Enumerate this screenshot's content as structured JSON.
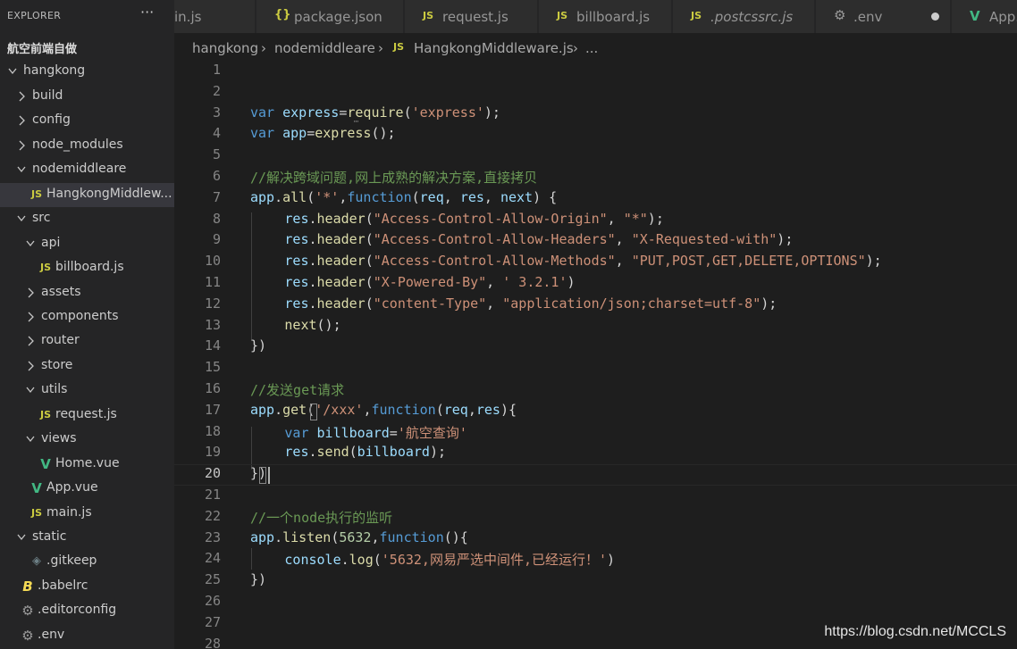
{
  "colors": {
    "keyword": "#569cd6",
    "variable": "#9cdcfe",
    "function": "#dcdcaa",
    "string": "#ce9178",
    "comment": "#6a9955",
    "number": "#b5cea8",
    "punct": "#d4d4d4",
    "js_badge": "#cbcb41",
    "vue_badge": "#42b883",
    "json_badge": "#cbcb41",
    "babel_badge": "#f5da55",
    "gear_icon": "#9a9a9a"
  },
  "sidebar": {
    "title": "EXPLORER",
    "more_icon": "ellipsis-icon",
    "tree": [
      {
        "label": "航空前端自做",
        "depth": 0,
        "kind": "root",
        "chevron": "none"
      },
      {
        "label": "hangkong",
        "depth": 0,
        "kind": "folder",
        "chevron": "open"
      },
      {
        "label": "build",
        "depth": 1,
        "kind": "folder",
        "chevron": "closed"
      },
      {
        "label": "config",
        "depth": 1,
        "kind": "folder",
        "chevron": "closed"
      },
      {
        "label": "node_modules",
        "depth": 1,
        "kind": "folder",
        "chevron": "closed"
      },
      {
        "label": "nodemiddleare",
        "depth": 1,
        "kind": "folder",
        "chevron": "open"
      },
      {
        "label": "HangkongMiddlew...",
        "depth": 2,
        "kind": "js",
        "chevron": "none",
        "selected": true
      },
      {
        "label": "src",
        "depth": 1,
        "kind": "folder",
        "chevron": "open"
      },
      {
        "label": "api",
        "depth": 2,
        "kind": "folder",
        "chevron": "open"
      },
      {
        "label": "billboard.js",
        "depth": 3,
        "kind": "js",
        "chevron": "none"
      },
      {
        "label": "assets",
        "depth": 2,
        "kind": "folder",
        "chevron": "closed"
      },
      {
        "label": "components",
        "depth": 2,
        "kind": "folder",
        "chevron": "closed"
      },
      {
        "label": "router",
        "depth": 2,
        "kind": "folder",
        "chevron": "closed"
      },
      {
        "label": "store",
        "depth": 2,
        "kind": "folder",
        "chevron": "closed"
      },
      {
        "label": "utils",
        "depth": 2,
        "kind": "folder",
        "chevron": "open"
      },
      {
        "label": "request.js",
        "depth": 3,
        "kind": "js",
        "chevron": "none"
      },
      {
        "label": "views",
        "depth": 2,
        "kind": "folder",
        "chevron": "open"
      },
      {
        "label": "Home.vue",
        "depth": 3,
        "kind": "vue",
        "chevron": "none"
      },
      {
        "label": "App.vue",
        "depth": 2,
        "kind": "vue",
        "chevron": "none"
      },
      {
        "label": "main.js",
        "depth": 2,
        "kind": "js",
        "chevron": "none"
      },
      {
        "label": "static",
        "depth": 1,
        "kind": "folder",
        "chevron": "open"
      },
      {
        "label": ".gitkeep",
        "depth": 2,
        "kind": "gitkeep",
        "chevron": "none"
      },
      {
        "label": ".babelrc",
        "depth": 1,
        "kind": "babel",
        "chevron": "none"
      },
      {
        "label": ".editorconfig",
        "depth": 1,
        "kind": "gear",
        "chevron": "none"
      },
      {
        "label": ".env",
        "depth": 1,
        "kind": "gear",
        "chevron": "none"
      }
    ]
  },
  "tabs": [
    {
      "label": "in.js",
      "kind": "none"
    },
    {
      "label": "package.json",
      "kind": "json"
    },
    {
      "label": "request.js",
      "kind": "js"
    },
    {
      "label": "billboard.js",
      "kind": "js"
    },
    {
      "label": ".postcssrc.js",
      "kind": "js",
      "italic": true
    },
    {
      "label": ".env",
      "kind": "gear",
      "dirty": true
    },
    {
      "label": "App.v",
      "kind": "vue"
    }
  ],
  "badges": {
    "js": "JS",
    "json": "{}",
    "vue": "V",
    "babel": "B"
  },
  "breadcrumb": {
    "items": [
      "hangkong",
      "nodemiddleare",
      "HangkongMiddleware.js",
      "..."
    ],
    "file_badge": "JS",
    "separator": "›"
  },
  "editor": {
    "current_line": 20,
    "lines": [
      {
        "n": "1",
        "indent": 0,
        "tokens": []
      },
      {
        "n": "2",
        "indent": 0,
        "tokens": []
      },
      {
        "n": "3",
        "indent": 0,
        "tokens": [
          [
            "keyword",
            "var"
          ],
          [
            "punct",
            " "
          ],
          [
            "variable",
            "express"
          ],
          [
            "punct",
            "="
          ],
          [
            "function",
            "require"
          ],
          [
            "punct",
            "("
          ],
          [
            "string",
            "'express'"
          ],
          [
            "punct",
            ");"
          ]
        ]
      },
      {
        "n": "4",
        "indent": 0,
        "tokens": [
          [
            "keyword",
            "var"
          ],
          [
            "punct",
            " "
          ],
          [
            "variable",
            "app"
          ],
          [
            "punct",
            "="
          ],
          [
            "function",
            "express"
          ],
          [
            "punct",
            "();"
          ]
        ]
      },
      {
        "n": "5",
        "indent": 0,
        "tokens": []
      },
      {
        "n": "6",
        "indent": 0,
        "tokens": [
          [
            "comment",
            "//解决跨域问题,网上成熟的解决方案,直接拷贝"
          ]
        ]
      },
      {
        "n": "7",
        "indent": 0,
        "tokens": [
          [
            "variable",
            "app"
          ],
          [
            "punct",
            "."
          ],
          [
            "function",
            "all"
          ],
          [
            "punct",
            "("
          ],
          [
            "string",
            "'*'"
          ],
          [
            "punct",
            ","
          ],
          [
            "keyword",
            "function"
          ],
          [
            "punct",
            "("
          ],
          [
            "variable",
            "req"
          ],
          [
            "punct",
            ", "
          ],
          [
            "variable",
            "res"
          ],
          [
            "punct",
            ", "
          ],
          [
            "variable",
            "next"
          ],
          [
            "punct",
            ") {"
          ]
        ]
      },
      {
        "n": "8",
        "indent": 1,
        "tokens": [
          [
            "variable",
            "res"
          ],
          [
            "punct",
            "."
          ],
          [
            "function",
            "header"
          ],
          [
            "punct",
            "("
          ],
          [
            "string",
            "\"Access-Control-Allow-Origin\""
          ],
          [
            "punct",
            ", "
          ],
          [
            "string",
            "\"*\""
          ],
          [
            "punct",
            ");"
          ]
        ]
      },
      {
        "n": "9",
        "indent": 1,
        "tokens": [
          [
            "variable",
            "res"
          ],
          [
            "punct",
            "."
          ],
          [
            "function",
            "header"
          ],
          [
            "punct",
            "("
          ],
          [
            "string",
            "\"Access-Control-Allow-Headers\""
          ],
          [
            "punct",
            ", "
          ],
          [
            "string",
            "\"X-Requested-with\""
          ],
          [
            "punct",
            ");"
          ]
        ]
      },
      {
        "n": "10",
        "indent": 1,
        "tokens": [
          [
            "variable",
            "res"
          ],
          [
            "punct",
            "."
          ],
          [
            "function",
            "header"
          ],
          [
            "punct",
            "("
          ],
          [
            "string",
            "\"Access-Control-Allow-Methods\""
          ],
          [
            "punct",
            ", "
          ],
          [
            "string",
            "\"PUT,POST,GET,DELETE,OPTIONS\""
          ],
          [
            "punct",
            ");"
          ]
        ]
      },
      {
        "n": "11",
        "indent": 1,
        "tokens": [
          [
            "variable",
            "res"
          ],
          [
            "punct",
            "."
          ],
          [
            "function",
            "header"
          ],
          [
            "punct",
            "("
          ],
          [
            "string",
            "\"X-Powered-By\""
          ],
          [
            "punct",
            ", "
          ],
          [
            "string",
            "' 3.2.1'"
          ],
          [
            "punct",
            ")"
          ]
        ]
      },
      {
        "n": "12",
        "indent": 1,
        "tokens": [
          [
            "variable",
            "res"
          ],
          [
            "punct",
            "."
          ],
          [
            "function",
            "header"
          ],
          [
            "punct",
            "("
          ],
          [
            "string",
            "\"content-Type\""
          ],
          [
            "punct",
            ", "
          ],
          [
            "string",
            "\"application/json;charset=utf-8\""
          ],
          [
            "punct",
            ");"
          ]
        ]
      },
      {
        "n": "13",
        "indent": 1,
        "tokens": [
          [
            "function",
            "next"
          ],
          [
            "punct",
            "();"
          ]
        ]
      },
      {
        "n": "14",
        "indent": 0,
        "tokens": [
          [
            "punct",
            "})"
          ]
        ]
      },
      {
        "n": "15",
        "indent": 0,
        "tokens": []
      },
      {
        "n": "16",
        "indent": 0,
        "tokens": [
          [
            "comment",
            "//发送get请求"
          ]
        ]
      },
      {
        "n": "17",
        "indent": 0,
        "tokens": [
          [
            "variable",
            "app"
          ],
          [
            "punct",
            "."
          ],
          [
            "function",
            "get"
          ],
          [
            "punct",
            "("
          ],
          [
            "string",
            "'/xxx'"
          ],
          [
            "punct",
            ","
          ],
          [
            "keyword",
            "function"
          ],
          [
            "punct",
            "("
          ],
          [
            "variable",
            "req"
          ],
          [
            "punct",
            ","
          ],
          [
            "variable",
            "res"
          ],
          [
            "punct",
            "){"
          ]
        ]
      },
      {
        "n": "18",
        "indent": 1,
        "tokens": [
          [
            "keyword",
            "var"
          ],
          [
            "punct",
            " "
          ],
          [
            "variable",
            "billboard"
          ],
          [
            "punct",
            "="
          ],
          [
            "string",
            "'航空查询'"
          ]
        ]
      },
      {
        "n": "19",
        "indent": 1,
        "tokens": [
          [
            "variable",
            "res"
          ],
          [
            "punct",
            "."
          ],
          [
            "function",
            "send"
          ],
          [
            "punct",
            "("
          ],
          [
            "variable",
            "billboard"
          ],
          [
            "punct",
            ");"
          ]
        ]
      },
      {
        "n": "20",
        "indent": 0,
        "tokens": [
          [
            "punct",
            "})"
          ]
        ]
      },
      {
        "n": "21",
        "indent": 0,
        "tokens": []
      },
      {
        "n": "22",
        "indent": 0,
        "tokens": [
          [
            "comment",
            "//一个node执行的监听"
          ]
        ]
      },
      {
        "n": "23",
        "indent": 0,
        "tokens": [
          [
            "variable",
            "app"
          ],
          [
            "punct",
            "."
          ],
          [
            "function",
            "listen"
          ],
          [
            "punct",
            "("
          ],
          [
            "number",
            "5632"
          ],
          [
            "punct",
            ","
          ],
          [
            "keyword",
            "function"
          ],
          [
            "punct",
            "(){"
          ]
        ]
      },
      {
        "n": "24",
        "indent": 1,
        "tokens": [
          [
            "variable",
            "console"
          ],
          [
            "punct",
            "."
          ],
          [
            "function",
            "log"
          ],
          [
            "punct",
            "("
          ],
          [
            "string",
            "'5632,网易严选中间件,已经运行！'"
          ],
          [
            "punct",
            ")"
          ]
        ]
      },
      {
        "n": "25",
        "indent": 0,
        "tokens": [
          [
            "punct",
            "})"
          ]
        ]
      },
      {
        "n": "26",
        "indent": 0,
        "tokens": []
      },
      {
        "n": "27",
        "indent": 0,
        "tokens": []
      },
      {
        "n": "28",
        "indent": 0,
        "tokens": []
      }
    ]
  },
  "watermark": "https://blog.csdn.net/MCCLS"
}
